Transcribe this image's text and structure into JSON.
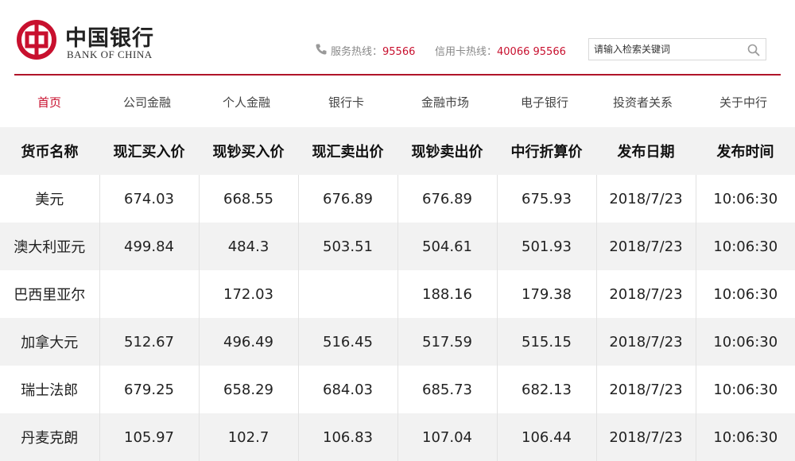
{
  "brand": {
    "name_cn": "中国银行",
    "name_en": "BANK OF CHINA",
    "color": "#c8102e"
  },
  "hotlines": {
    "service_label": "服务热线：",
    "service_number": "95566",
    "credit_label": "信用卡热线：",
    "credit_number": "40066 95566"
  },
  "search": {
    "placeholder": "请输入检索关键词"
  },
  "nav": [
    {
      "label": "首页",
      "active": true
    },
    {
      "label": "公司金融"
    },
    {
      "label": "个人金融"
    },
    {
      "label": "银行卡"
    },
    {
      "label": "金融市场"
    },
    {
      "label": "电子银行"
    },
    {
      "label": "投资者关系"
    },
    {
      "label": "关于中行"
    }
  ],
  "table": {
    "columns": [
      "货币名称",
      "现汇买入价",
      "现钞买入价",
      "现汇卖出价",
      "现钞卖出价",
      "中行折算价",
      "发布日期",
      "发布时间"
    ],
    "rows": [
      [
        "美元",
        "674.03",
        "668.55",
        "676.89",
        "676.89",
        "675.93",
        "2018/7/23",
        "10:06:30"
      ],
      [
        "澳大利亚元",
        "499.84",
        "484.3",
        "503.51",
        "504.61",
        "501.93",
        "2018/7/23",
        "10:06:30"
      ],
      [
        "巴西里亚尔",
        "",
        "172.03",
        "",
        "188.16",
        "179.38",
        "2018/7/23",
        "10:06:30"
      ],
      [
        "加拿大元",
        "512.67",
        "496.49",
        "516.45",
        "517.59",
        "515.15",
        "2018/7/23",
        "10:06:30"
      ],
      [
        "瑞士法郎",
        "679.25",
        "658.29",
        "684.03",
        "685.73",
        "682.13",
        "2018/7/23",
        "10:06:30"
      ],
      [
        "丹麦克朗",
        "105.97",
        "102.7",
        "106.83",
        "107.04",
        "106.44",
        "2018/7/23",
        "10:06:30"
      ]
    ]
  },
  "icons": {
    "logo": "bank-of-china-logo-icon",
    "phone": "phone-icon",
    "search": "search-icon"
  }
}
